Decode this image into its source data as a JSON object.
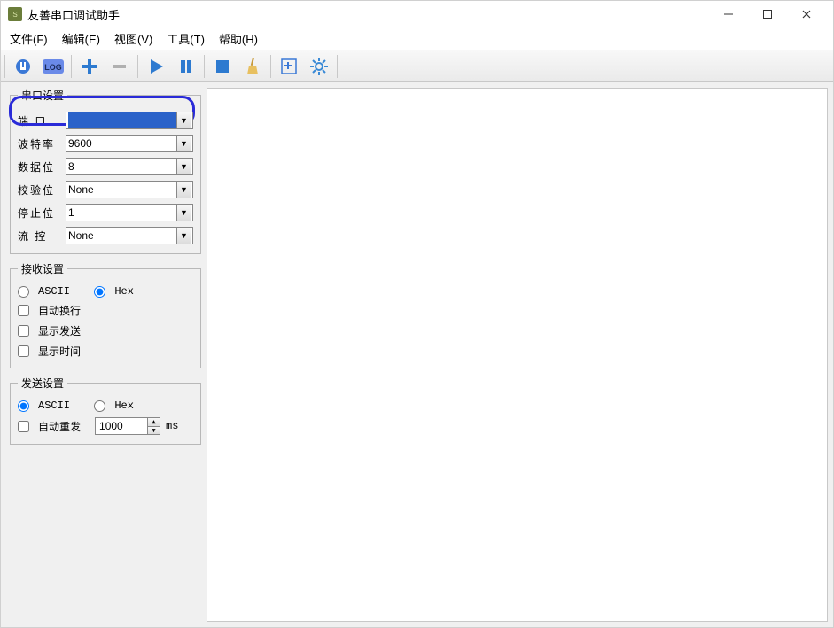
{
  "window": {
    "title": "友善串口调试助手",
    "icon_label": "S"
  },
  "menu": {
    "file": "文件(F)",
    "edit": "编辑(E)",
    "view": "视图(V)",
    "tools": "工具(T)",
    "help": "帮助(H)"
  },
  "serial": {
    "legend": "串口设置",
    "port_label": "端  口",
    "port_value": "",
    "baud_label": "波特率",
    "baud_value": "9600",
    "databits_label": "数据位",
    "databits_value": "8",
    "parity_label": "校验位",
    "parity_value": "None",
    "stopbits_label": "停止位",
    "stopbits_value": "1",
    "flow_label": "流  控",
    "flow_value": "None"
  },
  "recv": {
    "legend": "接收设置",
    "ascii": "ASCII",
    "hex": "Hex",
    "autowrap": "自动换行",
    "showsend": "显示发送",
    "showtime": "显示时间"
  },
  "send": {
    "legend": "发送设置",
    "ascii": "ASCII",
    "hex": "Hex",
    "autoresend": "自动重发",
    "interval": "1000",
    "unit": "ms"
  }
}
